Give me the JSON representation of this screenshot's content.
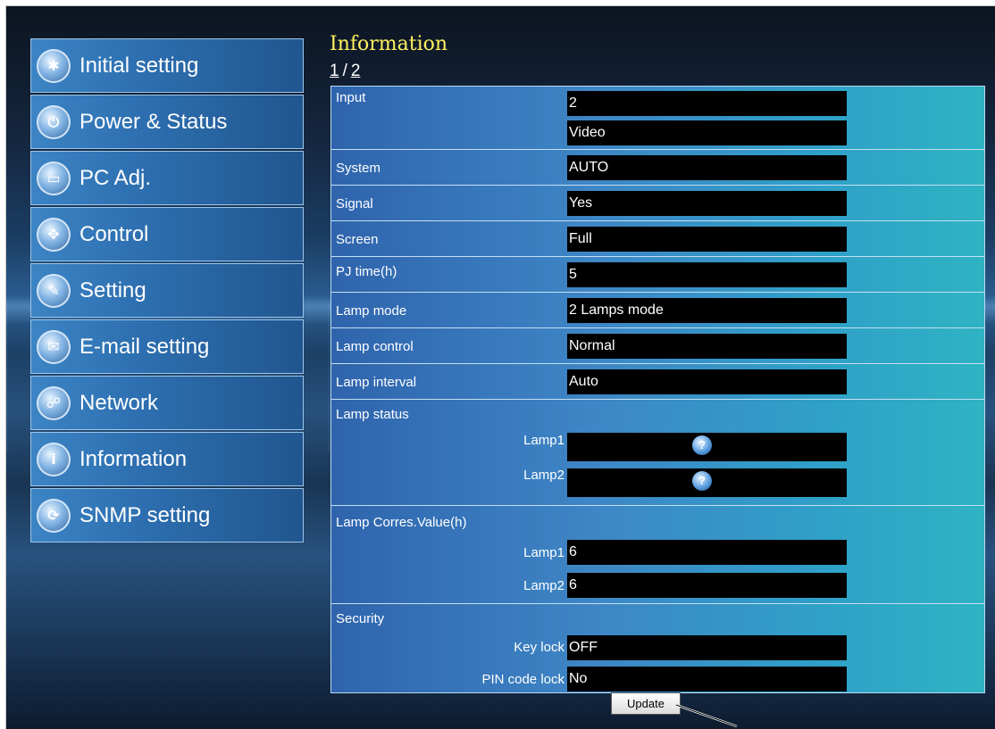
{
  "sidebar": {
    "items": [
      {
        "label": "Initial setting",
        "icon": "wrench-gear-icon"
      },
      {
        "label": "Power & Status",
        "icon": "power-icon"
      },
      {
        "label": "PC Adj.",
        "icon": "monitor-icon"
      },
      {
        "label": "Control",
        "icon": "control-icon"
      },
      {
        "label": "Setting",
        "icon": "tools-icon"
      },
      {
        "label": "E-mail setting",
        "icon": "mail-icon"
      },
      {
        "label": "Network",
        "icon": "network-icon"
      },
      {
        "label": "Information",
        "icon": "info-icon"
      },
      {
        "label": "SNMP setting",
        "icon": "snmp-icon"
      }
    ]
  },
  "header": {
    "title": "Information",
    "page_current": "1",
    "page_sep": "/",
    "page_next": "2"
  },
  "info": {
    "input_label": "Input",
    "input_value1": "2",
    "input_value2": "Video",
    "system_label": "System",
    "system_value": "AUTO",
    "signal_label": "Signal",
    "signal_value": "Yes",
    "screen_label": "Screen",
    "screen_value": "Full",
    "pjtime_label": "PJ time(h)",
    "pjtime_value": "5",
    "lampmode_label": "Lamp mode",
    "lampmode_value": "2 Lamps mode",
    "lampcontrol_label": "Lamp control",
    "lampcontrol_value": "Normal",
    "lampinterval_label": "Lamp interval",
    "lampinterval_value": "Auto",
    "lampstatus_label": "Lamp status",
    "lamp1_label": "Lamp1",
    "lamp2_label": "Lamp2",
    "corres_label": "Lamp Corres.Value(h)",
    "corres_lamp1_label": "Lamp1",
    "corres_lamp1_value": "6",
    "corres_lamp2_label": "Lamp2",
    "corres_lamp2_value": "6",
    "security_label": "Security",
    "keylock_label": "Key lock",
    "keylock_value": "OFF",
    "pinlock_label": "PIN code lock",
    "pinlock_value": "No"
  },
  "update_label": "Update"
}
